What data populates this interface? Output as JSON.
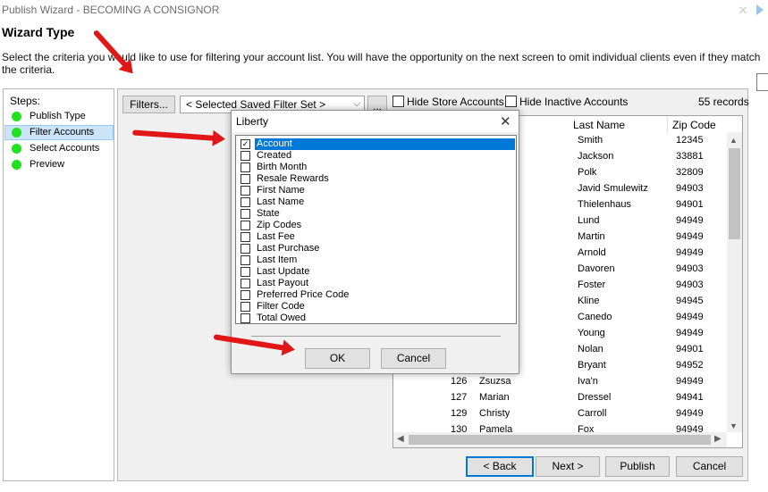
{
  "window": {
    "title": "Publish Wizard - BECOMING A CONSIGNOR",
    "close_glyph": "✕"
  },
  "wizard": {
    "heading": "Wizard Type",
    "description": "Select the criteria you would like to use for filtering your account list.  You will have the opportunity on the next screen to omit individual clients even if they match the criteria."
  },
  "steps": {
    "label": "Steps:",
    "items": [
      {
        "label": "Publish Type"
      },
      {
        "label": "Filter Accounts"
      },
      {
        "label": "Select Accounts"
      },
      {
        "label": "Preview"
      }
    ]
  },
  "toolbar": {
    "filters_label": "Filters...",
    "saved_filter_value": "< Selected Saved Filter Set >",
    "dots_label": "...",
    "hide_store_label": "Hide Store Accounts",
    "hide_inactive_label": "Hide Inactive Accounts",
    "record_count": "55 records"
  },
  "grid": {
    "columns": [
      "Last Name",
      "Zip Code"
    ],
    "rows": [
      {
        "id": "",
        "first": "",
        "last": "Smith",
        "zip": "12345"
      },
      {
        "id": "",
        "first": "",
        "last": "Jackson",
        "zip": "33881"
      },
      {
        "id": "",
        "first": "",
        "last": "Polk",
        "zip": "32809"
      },
      {
        "id": "",
        "first": "",
        "last": "Javid Smulewitz",
        "zip": "94903"
      },
      {
        "id": "",
        "first": "",
        "last": "Thielenhaus",
        "zip": "94901"
      },
      {
        "id": "",
        "first": "",
        "last": "Lund",
        "zip": "94949"
      },
      {
        "id": "",
        "first": "",
        "last": "Martin",
        "zip": "94949"
      },
      {
        "id": "",
        "first": "",
        "last": "Arnold",
        "zip": "94949"
      },
      {
        "id": "",
        "first": "",
        "last": "Davoren",
        "zip": "94903"
      },
      {
        "id": "",
        "first": "",
        "last": "Foster",
        "zip": "94903"
      },
      {
        "id": "",
        "first": "",
        "last": "Kline",
        "zip": "94945"
      },
      {
        "id": "",
        "first": "",
        "last": "Canedo",
        "zip": "94949"
      },
      {
        "id": "",
        "first": "",
        "last": "Young",
        "zip": "94949"
      },
      {
        "id": "",
        "first": "",
        "last": "Nolan",
        "zip": "94901"
      },
      {
        "id": "",
        "first": "",
        "last": "Bryant",
        "zip": "94952"
      },
      {
        "id": "126",
        "first": "Zsuzsa",
        "last": "Iva'n",
        "zip": "94949"
      },
      {
        "id": "127",
        "first": "Marian",
        "last": "Dressel",
        "zip": "94941"
      },
      {
        "id": "129",
        "first": "Christy",
        "last": "Carroll",
        "zip": "94949"
      },
      {
        "id": "130",
        "first": "Pamela",
        "last": "Fox",
        "zip": "94949"
      }
    ]
  },
  "nav": {
    "back": "< Back",
    "next": "Next >",
    "publish": "Publish",
    "cancel": "Cancel"
  },
  "dialog": {
    "title": "Liberty",
    "close_glyph": "✕",
    "checkmark": "✓",
    "options": [
      {
        "label": "Account",
        "checked": true
      },
      {
        "label": "Created",
        "checked": false
      },
      {
        "label": "Birth Month",
        "checked": false
      },
      {
        "label": "Resale Rewards",
        "checked": false
      },
      {
        "label": "First Name",
        "checked": false
      },
      {
        "label": "Last Name",
        "checked": false
      },
      {
        "label": "State",
        "checked": false
      },
      {
        "label": "Zip Codes",
        "checked": false
      },
      {
        "label": "Last Fee",
        "checked": false
      },
      {
        "label": "Last Purchase",
        "checked": false
      },
      {
        "label": "Last Item",
        "checked": false
      },
      {
        "label": "Last Update",
        "checked": false
      },
      {
        "label": "Last Payout",
        "checked": false
      },
      {
        "label": "Preferred Price Code",
        "checked": false
      },
      {
        "label": "Filter Code",
        "checked": false
      },
      {
        "label": "Total Owed",
        "checked": false
      }
    ],
    "ok_label": "OK",
    "cancel_label": "Cancel"
  },
  "colors": {
    "accent": "#0078d7",
    "step_dot": "#1ee31e",
    "annotation_arrow": "#e11717"
  }
}
